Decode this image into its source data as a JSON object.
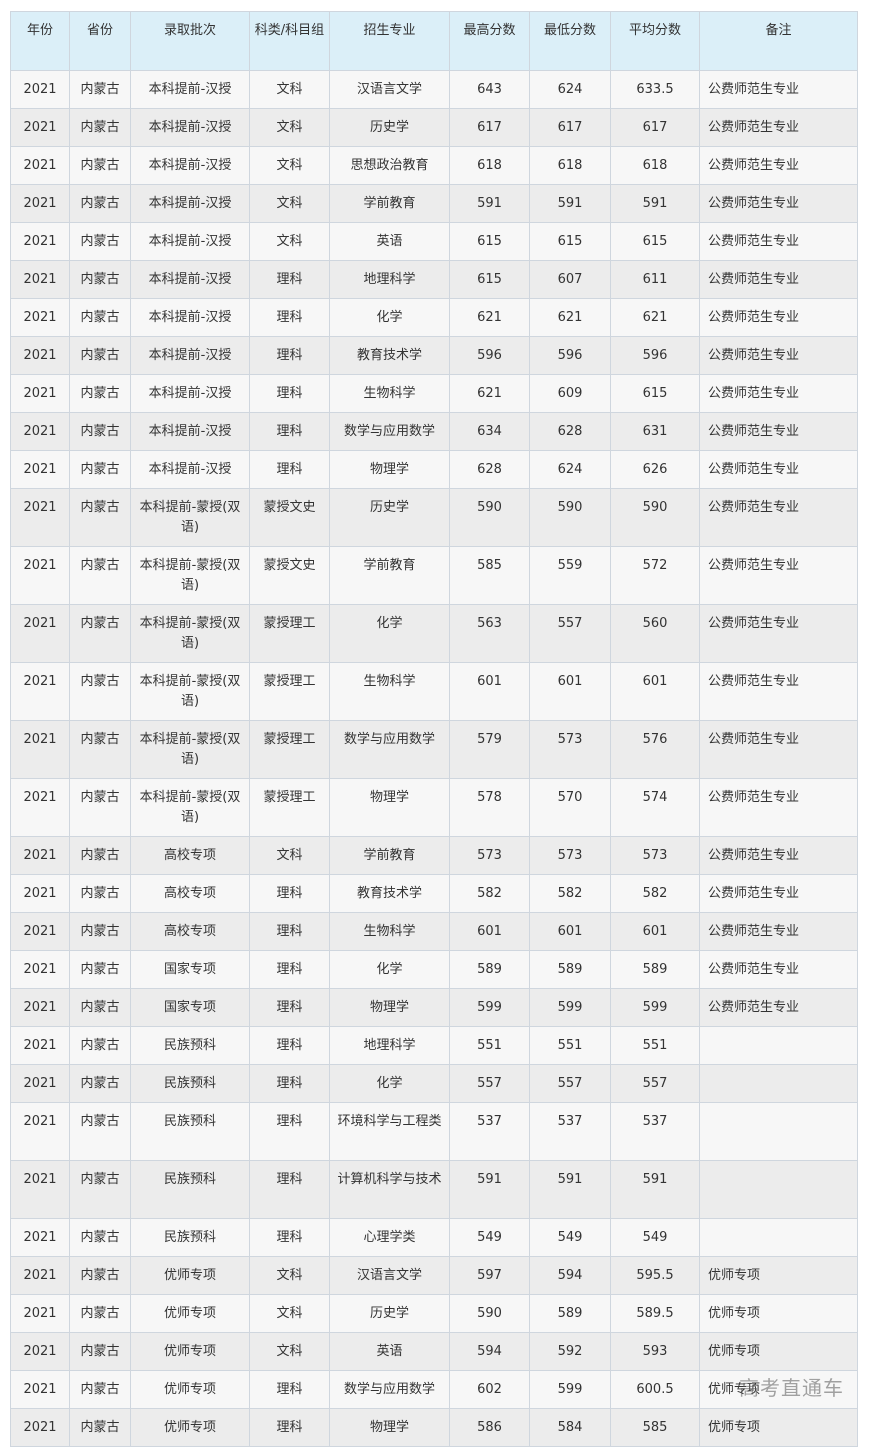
{
  "headers": [
    "年份",
    "省份",
    "录取批次",
    "科类/科目组",
    "招生专业",
    "最高分数",
    "最低分数",
    "平均分数",
    "备注"
  ],
  "rows": [
    [
      "2021",
      "内蒙古",
      "本科提前-汉授",
      "文科",
      "汉语言文学",
      "643",
      "624",
      "633.5",
      "公费师范生专业"
    ],
    [
      "2021",
      "内蒙古",
      "本科提前-汉授",
      "文科",
      "历史学",
      "617",
      "617",
      "617",
      "公费师范生专业"
    ],
    [
      "2021",
      "内蒙古",
      "本科提前-汉授",
      "文科",
      "思想政治教育",
      "618",
      "618",
      "618",
      "公费师范生专业"
    ],
    [
      "2021",
      "内蒙古",
      "本科提前-汉授",
      "文科",
      "学前教育",
      "591",
      "591",
      "591",
      "公费师范生专业"
    ],
    [
      "2021",
      "内蒙古",
      "本科提前-汉授",
      "文科",
      "英语",
      "615",
      "615",
      "615",
      "公费师范生专业"
    ],
    [
      "2021",
      "内蒙古",
      "本科提前-汉授",
      "理科",
      "地理科学",
      "615",
      "607",
      "611",
      "公费师范生专业"
    ],
    [
      "2021",
      "内蒙古",
      "本科提前-汉授",
      "理科",
      "化学",
      "621",
      "621",
      "621",
      "公费师范生专业"
    ],
    [
      "2021",
      "内蒙古",
      "本科提前-汉授",
      "理科",
      "教育技术学",
      "596",
      "596",
      "596",
      "公费师范生专业"
    ],
    [
      "2021",
      "内蒙古",
      "本科提前-汉授",
      "理科",
      "生物科学",
      "621",
      "609",
      "615",
      "公费师范生专业"
    ],
    [
      "2021",
      "内蒙古",
      "本科提前-汉授",
      "理科",
      "数学与应用数学",
      "634",
      "628",
      "631",
      "公费师范生专业"
    ],
    [
      "2021",
      "内蒙古",
      "本科提前-汉授",
      "理科",
      "物理学",
      "628",
      "624",
      "626",
      "公费师范生专业"
    ],
    [
      "2021",
      "内蒙古",
      "本科提前-蒙授(双语)",
      "蒙授文史",
      "历史学",
      "590",
      "590",
      "590",
      "公费师范生专业"
    ],
    [
      "2021",
      "内蒙古",
      "本科提前-蒙授(双语)",
      "蒙授文史",
      "学前教育",
      "585",
      "559",
      "572",
      "公费师范生专业"
    ],
    [
      "2021",
      "内蒙古",
      "本科提前-蒙授(双语)",
      "蒙授理工",
      "化学",
      "563",
      "557",
      "560",
      "公费师范生专业"
    ],
    [
      "2021",
      "内蒙古",
      "本科提前-蒙授(双语)",
      "蒙授理工",
      "生物科学",
      "601",
      "601",
      "601",
      "公费师范生专业"
    ],
    [
      "2021",
      "内蒙古",
      "本科提前-蒙授(双语)",
      "蒙授理工",
      "数学与应用数学",
      "579",
      "573",
      "576",
      "公费师范生专业"
    ],
    [
      "2021",
      "内蒙古",
      "本科提前-蒙授(双语)",
      "蒙授理工",
      "物理学",
      "578",
      "570",
      "574",
      "公费师范生专业"
    ],
    [
      "2021",
      "内蒙古",
      "高校专项",
      "文科",
      "学前教育",
      "573",
      "573",
      "573",
      "公费师范生专业"
    ],
    [
      "2021",
      "内蒙古",
      "高校专项",
      "理科",
      "教育技术学",
      "582",
      "582",
      "582",
      "公费师范生专业"
    ],
    [
      "2021",
      "内蒙古",
      "高校专项",
      "理科",
      "生物科学",
      "601",
      "601",
      "601",
      "公费师范生专业"
    ],
    [
      "2021",
      "内蒙古",
      "国家专项",
      "理科",
      "化学",
      "589",
      "589",
      "589",
      "公费师范生专业"
    ],
    [
      "2021",
      "内蒙古",
      "国家专项",
      "理科",
      "物理学",
      "599",
      "599",
      "599",
      "公费师范生专业"
    ],
    [
      "2021",
      "内蒙古",
      "民族预科",
      "理科",
      "地理科学",
      "551",
      "551",
      "551",
      ""
    ],
    [
      "2021",
      "内蒙古",
      "民族预科",
      "理科",
      "化学",
      "557",
      "557",
      "557",
      ""
    ],
    [
      "2021",
      "内蒙古",
      "民族预科",
      "理科",
      "环境科学与工程类",
      "537",
      "537",
      "537",
      ""
    ],
    [
      "2021",
      "内蒙古",
      "民族预科",
      "理科",
      "计算机科学与技术",
      "591",
      "591",
      "591",
      ""
    ],
    [
      "2021",
      "内蒙古",
      "民族预科",
      "理科",
      "心理学类",
      "549",
      "549",
      "549",
      ""
    ],
    [
      "2021",
      "内蒙古",
      "优师专项",
      "文科",
      "汉语言文学",
      "597",
      "594",
      "595.5",
      "优师专项"
    ],
    [
      "2021",
      "内蒙古",
      "优师专项",
      "文科",
      "历史学",
      "590",
      "589",
      "589.5",
      "优师专项"
    ],
    [
      "2021",
      "内蒙古",
      "优师专项",
      "文科",
      "英语",
      "594",
      "592",
      "593",
      "优师专项"
    ],
    [
      "2021",
      "内蒙古",
      "优师专项",
      "理科",
      "数学与应用数学",
      "602",
      "599",
      "600.5",
      "优师专项"
    ],
    [
      "2021",
      "内蒙古",
      "优师专项",
      "理科",
      "物理学",
      "586",
      "584",
      "585",
      "优师专项"
    ]
  ],
  "watermark": "高考直通车"
}
